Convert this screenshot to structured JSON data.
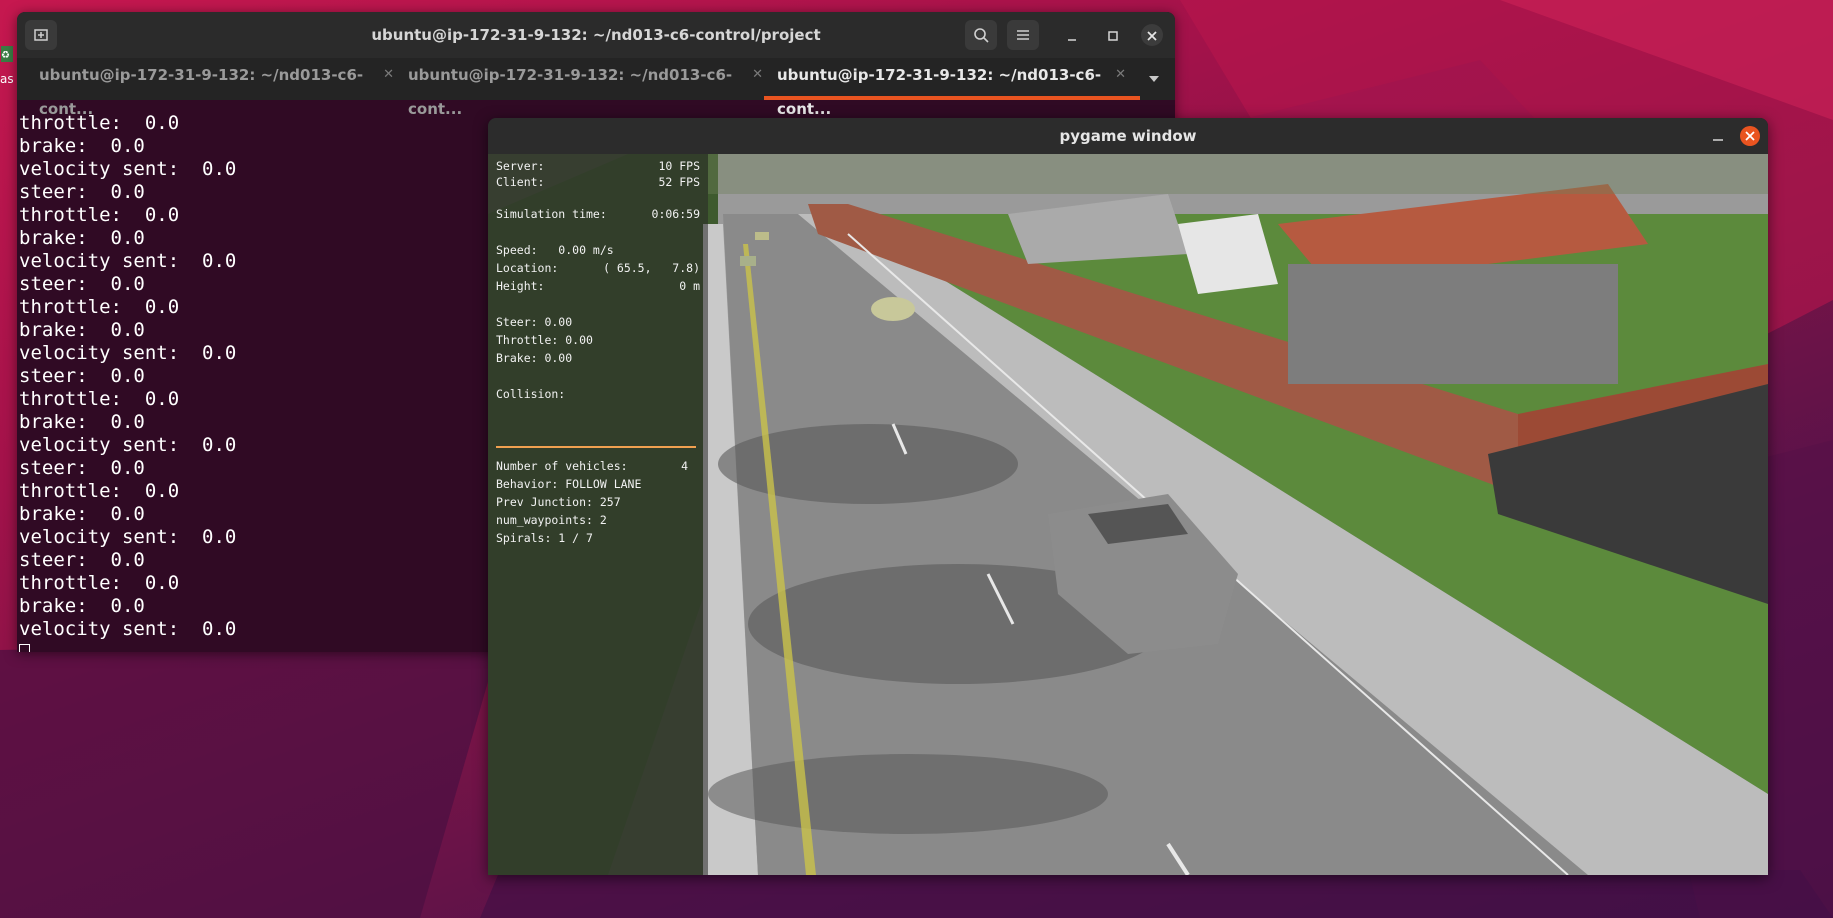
{
  "desktop": {
    "side_text": "as"
  },
  "terminal": {
    "title": "ubuntu@ip-172-31-9-132: ~/nd013-c6-control/project",
    "tabs": [
      {
        "label": "ubuntu@ip-172-31-9-132: ~/nd013-c6-cont..."
      },
      {
        "label": "ubuntu@ip-172-31-9-132: ~/nd013-c6-cont..."
      },
      {
        "label": "ubuntu@ip-172-31-9-132: ~/nd013-c6-cont..."
      }
    ],
    "lines": [
      "throttle:  0.0",
      "brake:  0.0",
      "velocity sent:  0.0",
      "steer:  0.0",
      "throttle:  0.0",
      "brake:  0.0",
      "velocity sent:  0.0",
      "steer:  0.0",
      "throttle:  0.0",
      "brake:  0.0",
      "velocity sent:  0.0",
      "steer:  0.0",
      "throttle:  0.0",
      "brake:  0.0",
      "velocity sent:  0.0",
      "steer:  0.0",
      "throttle:  0.0",
      "brake:  0.0",
      "velocity sent:  0.0",
      "steer:  0.0",
      "throttle:  0.0",
      "brake:  0.0",
      "velocity sent:  0.0"
    ]
  },
  "pygame": {
    "title": "pygame window",
    "hud": {
      "server_label": "Server:",
      "server_value": "10 FPS",
      "client_label": "Client:",
      "client_value": "52 FPS",
      "simtime_label": "Simulation time:",
      "simtime_value": "0:06:59",
      "speed": "Speed:   0.00 m/s",
      "location_label": "Location:",
      "location_value": "( 65.5,   7.8)",
      "height_label": "Height:",
      "height_value": "0 m",
      "steer": "Steer: 0.00",
      "throttle": "Throttle: 0.00",
      "brake": "Brake: 0.00",
      "collision": "Collision:",
      "vehicles_label": "Number of vehicles:",
      "vehicles_value": "4",
      "behavior": "Behavior: FOLLOW LANE",
      "prev_junction": "Prev Junction: 257",
      "num_waypoints": "num_waypoints: 2",
      "spirals": "Spirals: 1 / 7"
    }
  }
}
